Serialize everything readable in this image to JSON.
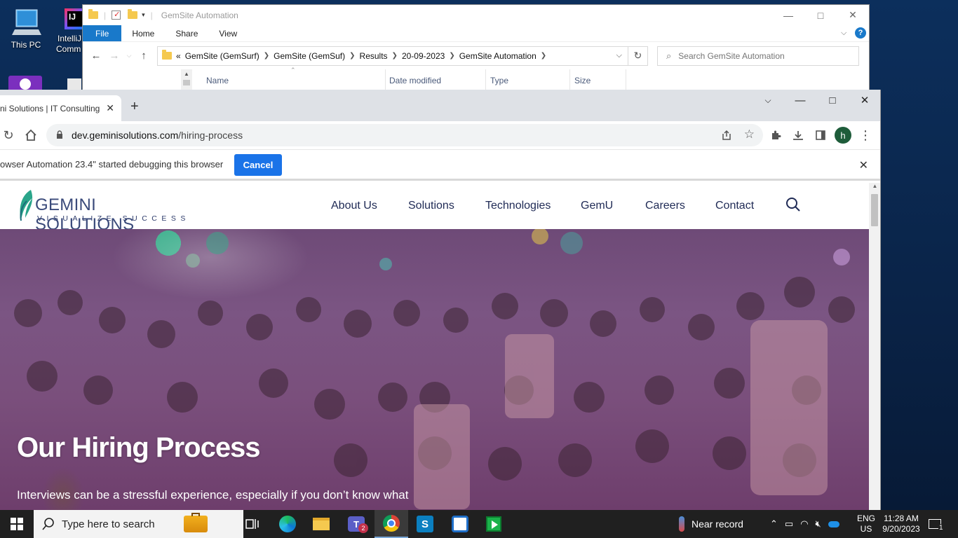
{
  "desktop": {
    "icons": [
      {
        "label": "This PC"
      },
      {
        "label_line1": "IntelliJ",
        "label_line2": "Comm"
      }
    ]
  },
  "explorer": {
    "title": "GemSite Automation",
    "ribbon": [
      "File",
      "Home",
      "Share",
      "View"
    ],
    "breadcrumb": [
      "GemSite (GemSurf)",
      "GemSite (GemSuf)",
      "Results",
      "20-09-2023",
      "GemSite Automation"
    ],
    "breadcrumb_prefix": "«",
    "search_placeholder": "Search GemSite Automation",
    "columns": [
      "Name",
      "Date modified",
      "Type",
      "Size"
    ],
    "help": "?"
  },
  "chrome": {
    "tab_title": "ni Solutions | IT Consulting",
    "url_host": "dev.geminisolutions.com",
    "url_path": "/hiring-process",
    "profile_initial": "h",
    "infobar_text": "owser Automation 23.4\" started debugging this browser",
    "cancel_label": "Cancel"
  },
  "site": {
    "logo_name": "GEMINI SOLUTIONS",
    "logo_tagline": "VISUALIZE SUCCESS",
    "nav": [
      "About Us",
      "Solutions",
      "Technologies",
      "GemU",
      "Careers",
      "Contact"
    ],
    "hero_title": "Our Hiring Process",
    "hero_text": "Interviews can be a stressful experience, especially if you don’t know what"
  },
  "taskbar": {
    "search_placeholder": "Type here to search",
    "weather_text": "Near record",
    "language": "ENG",
    "region": "US",
    "time": "11:28 AM",
    "date": "9/20/2023",
    "notifications": "1",
    "teams_badge": "2"
  },
  "colors": {
    "chrome_blue": "#1a73e8",
    "explorer_file_tab": "#1979ca",
    "site_nav_text": "#1f2a55",
    "taskbar": "#202020"
  }
}
